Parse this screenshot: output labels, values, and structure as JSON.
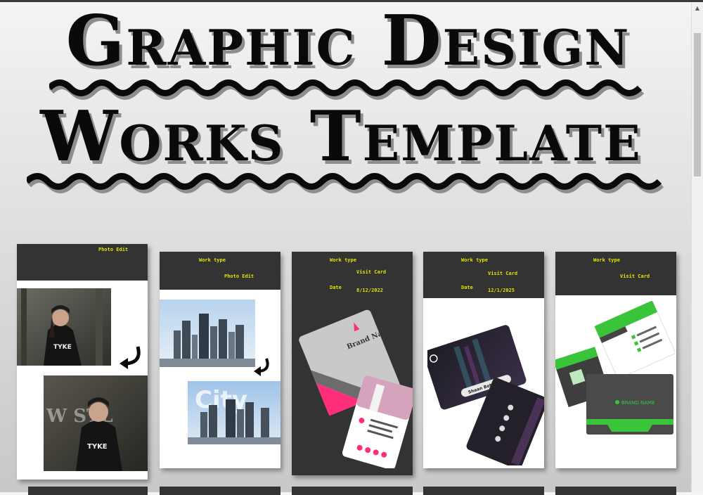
{
  "title": {
    "line1": "Graphic Design",
    "line2": "Works Template"
  },
  "cards": [
    {
      "labels": [
        "Photo Edit"
      ]
    },
    {
      "labels": [
        "Work type",
        "Photo Edit"
      ]
    },
    {
      "labels": [
        "Work type",
        "Visit Card",
        "Date",
        "8/12/2022"
      ]
    },
    {
      "labels": [
        "Work type",
        "Visit Card",
        "Date",
        "12/1/2025"
      ]
    },
    {
      "labels": [
        "Work type",
        "Visit Card"
      ]
    }
  ],
  "mockups": {
    "card3_brand": "Brand Name",
    "card4_name": "Shaan Bottu",
    "card5_brand": "BRAND NAME"
  },
  "colors": {
    "header": "#333333",
    "label": "#e8e800",
    "accent_pink": "#ff2d7a",
    "accent_green": "#39c43a"
  }
}
